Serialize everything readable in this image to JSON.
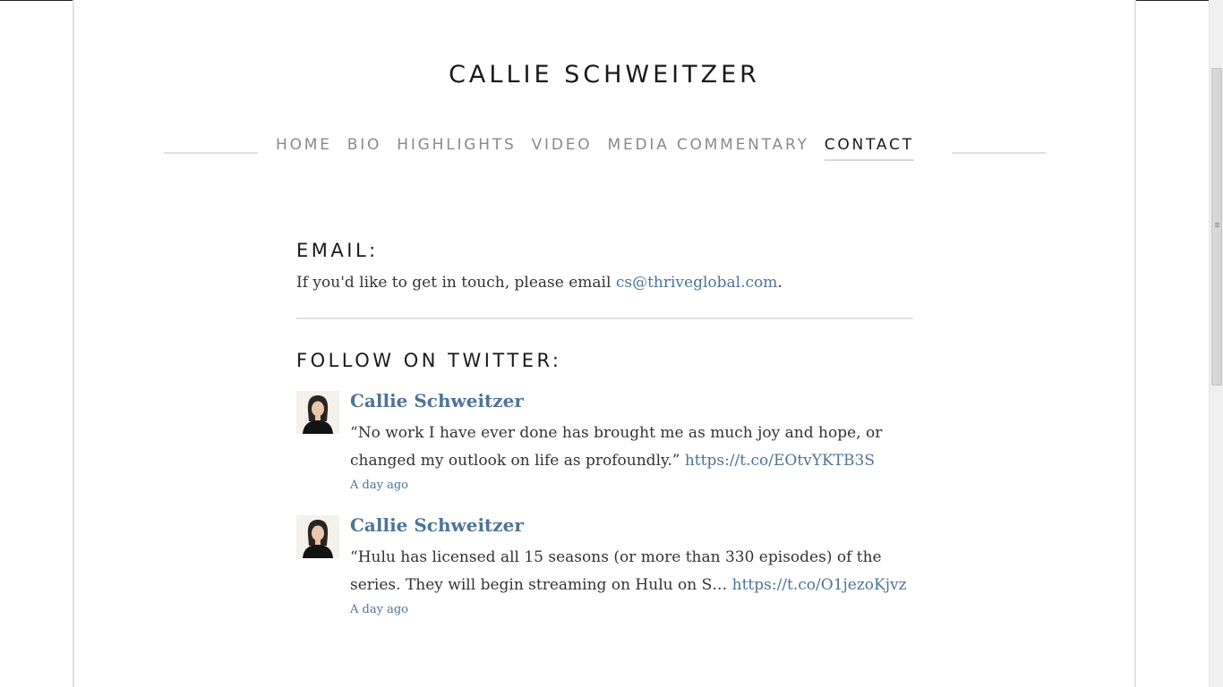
{
  "site": {
    "title": "CALLIE SCHWEITZER"
  },
  "nav": {
    "items": [
      {
        "label": "HOME"
      },
      {
        "label": "BIO"
      },
      {
        "label": "HIGHLIGHTS"
      },
      {
        "label": "VIDEO"
      },
      {
        "label": "MEDIA COMMENTARY"
      },
      {
        "label": "CONTACT"
      }
    ],
    "active": "CONTACT"
  },
  "email_section": {
    "heading": "EMAIL:",
    "text_before": "If you'd like to get in touch, please email ",
    "email_link": "cs@thriveglobal.com",
    "text_after": "."
  },
  "twitter_section": {
    "heading": "FOLLOW ON TWITTER:",
    "tweets": [
      {
        "author": "Callie Schweitzer",
        "text": "“No work I have ever done has brought me as much joy and hope, or changed my outlook on life as profoundly.” ",
        "link": "https://t.co/EOtvYKTB3S",
        "time": "A day ago"
      },
      {
        "author": "Callie Schweitzer",
        "text": "“Hulu has licensed all 15 seasons (or more than 330 episodes) of the series. They will begin streaming on Hulu on S… ",
        "link": "https://t.co/O1jezoKjvz",
        "time": "A day ago"
      }
    ]
  },
  "colors": {
    "link": "#4e7399",
    "heading": "#1a1a1a",
    "nav_inactive": "#8a8a8a",
    "body_text": "#333333"
  }
}
